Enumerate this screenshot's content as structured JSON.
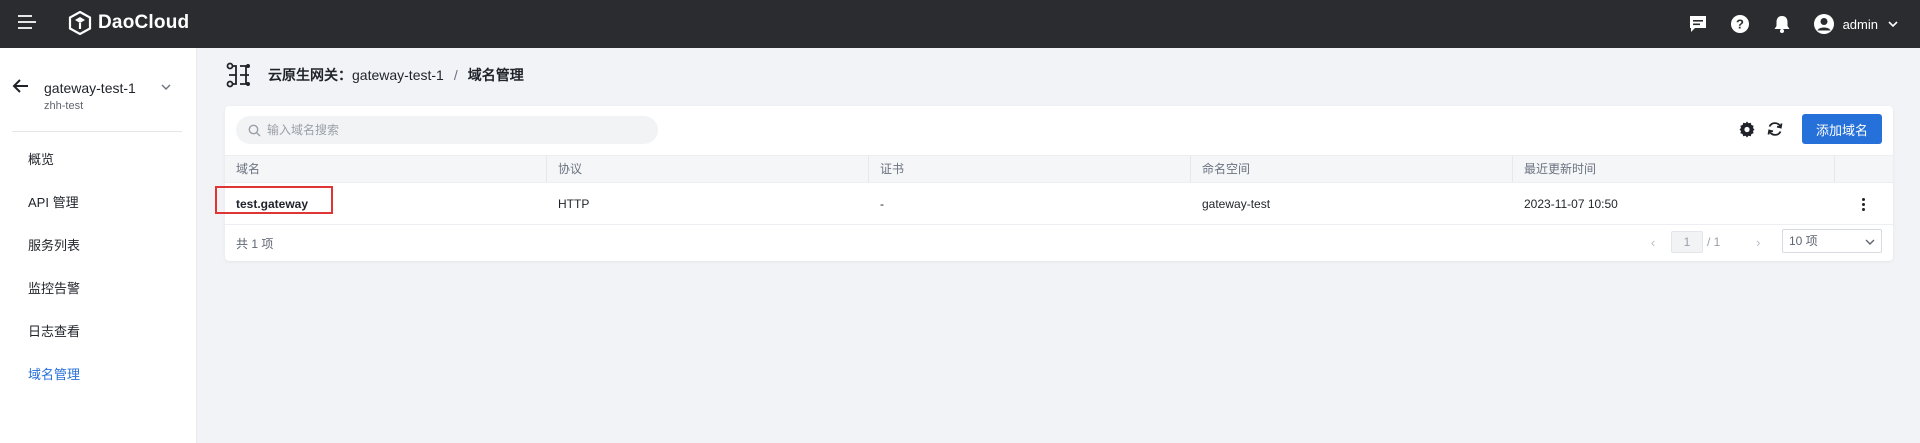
{
  "brand": {
    "name": "DaoCloud"
  },
  "topbar": {
    "username": "admin",
    "icons": [
      "menu-icon",
      "message-icon",
      "help-icon",
      "bell-icon",
      "user-avatar-icon",
      "chevron-down-icon"
    ]
  },
  "sidebar": {
    "workspace": "gateway-test-1",
    "namespace": "zhh-test",
    "items": [
      {
        "label": "概览",
        "active": false
      },
      {
        "label": "API 管理",
        "active": false
      },
      {
        "label": "服务列表",
        "active": false
      },
      {
        "label": "监控告警",
        "active": false
      },
      {
        "label": "日志查看",
        "active": false
      },
      {
        "label": "域名管理",
        "active": true
      }
    ]
  },
  "breadcrumb": {
    "root": "云原生网关：",
    "gateway": "gateway-test-1",
    "separator": "/",
    "current": "域名管理"
  },
  "toolbar": {
    "search_placeholder": "输入域名搜索",
    "add_label": "添加域名"
  },
  "table": {
    "columns": [
      "域名",
      "协议",
      "证书",
      "命名空间",
      "最近更新时间"
    ],
    "rows": [
      {
        "domain": "test.gateway",
        "protocol": "HTTP",
        "cert": "-",
        "namespace": "gateway-test",
        "updated": "2023-11-07 10:50"
      }
    ]
  },
  "pagination": {
    "total": "共 1 项",
    "current_page": "1",
    "total_pages": "/ 1",
    "page_size": "10 项"
  },
  "colors": {
    "accent": "#2671d9",
    "topbar": "#2b2c2f",
    "highlight": "#e03535"
  }
}
